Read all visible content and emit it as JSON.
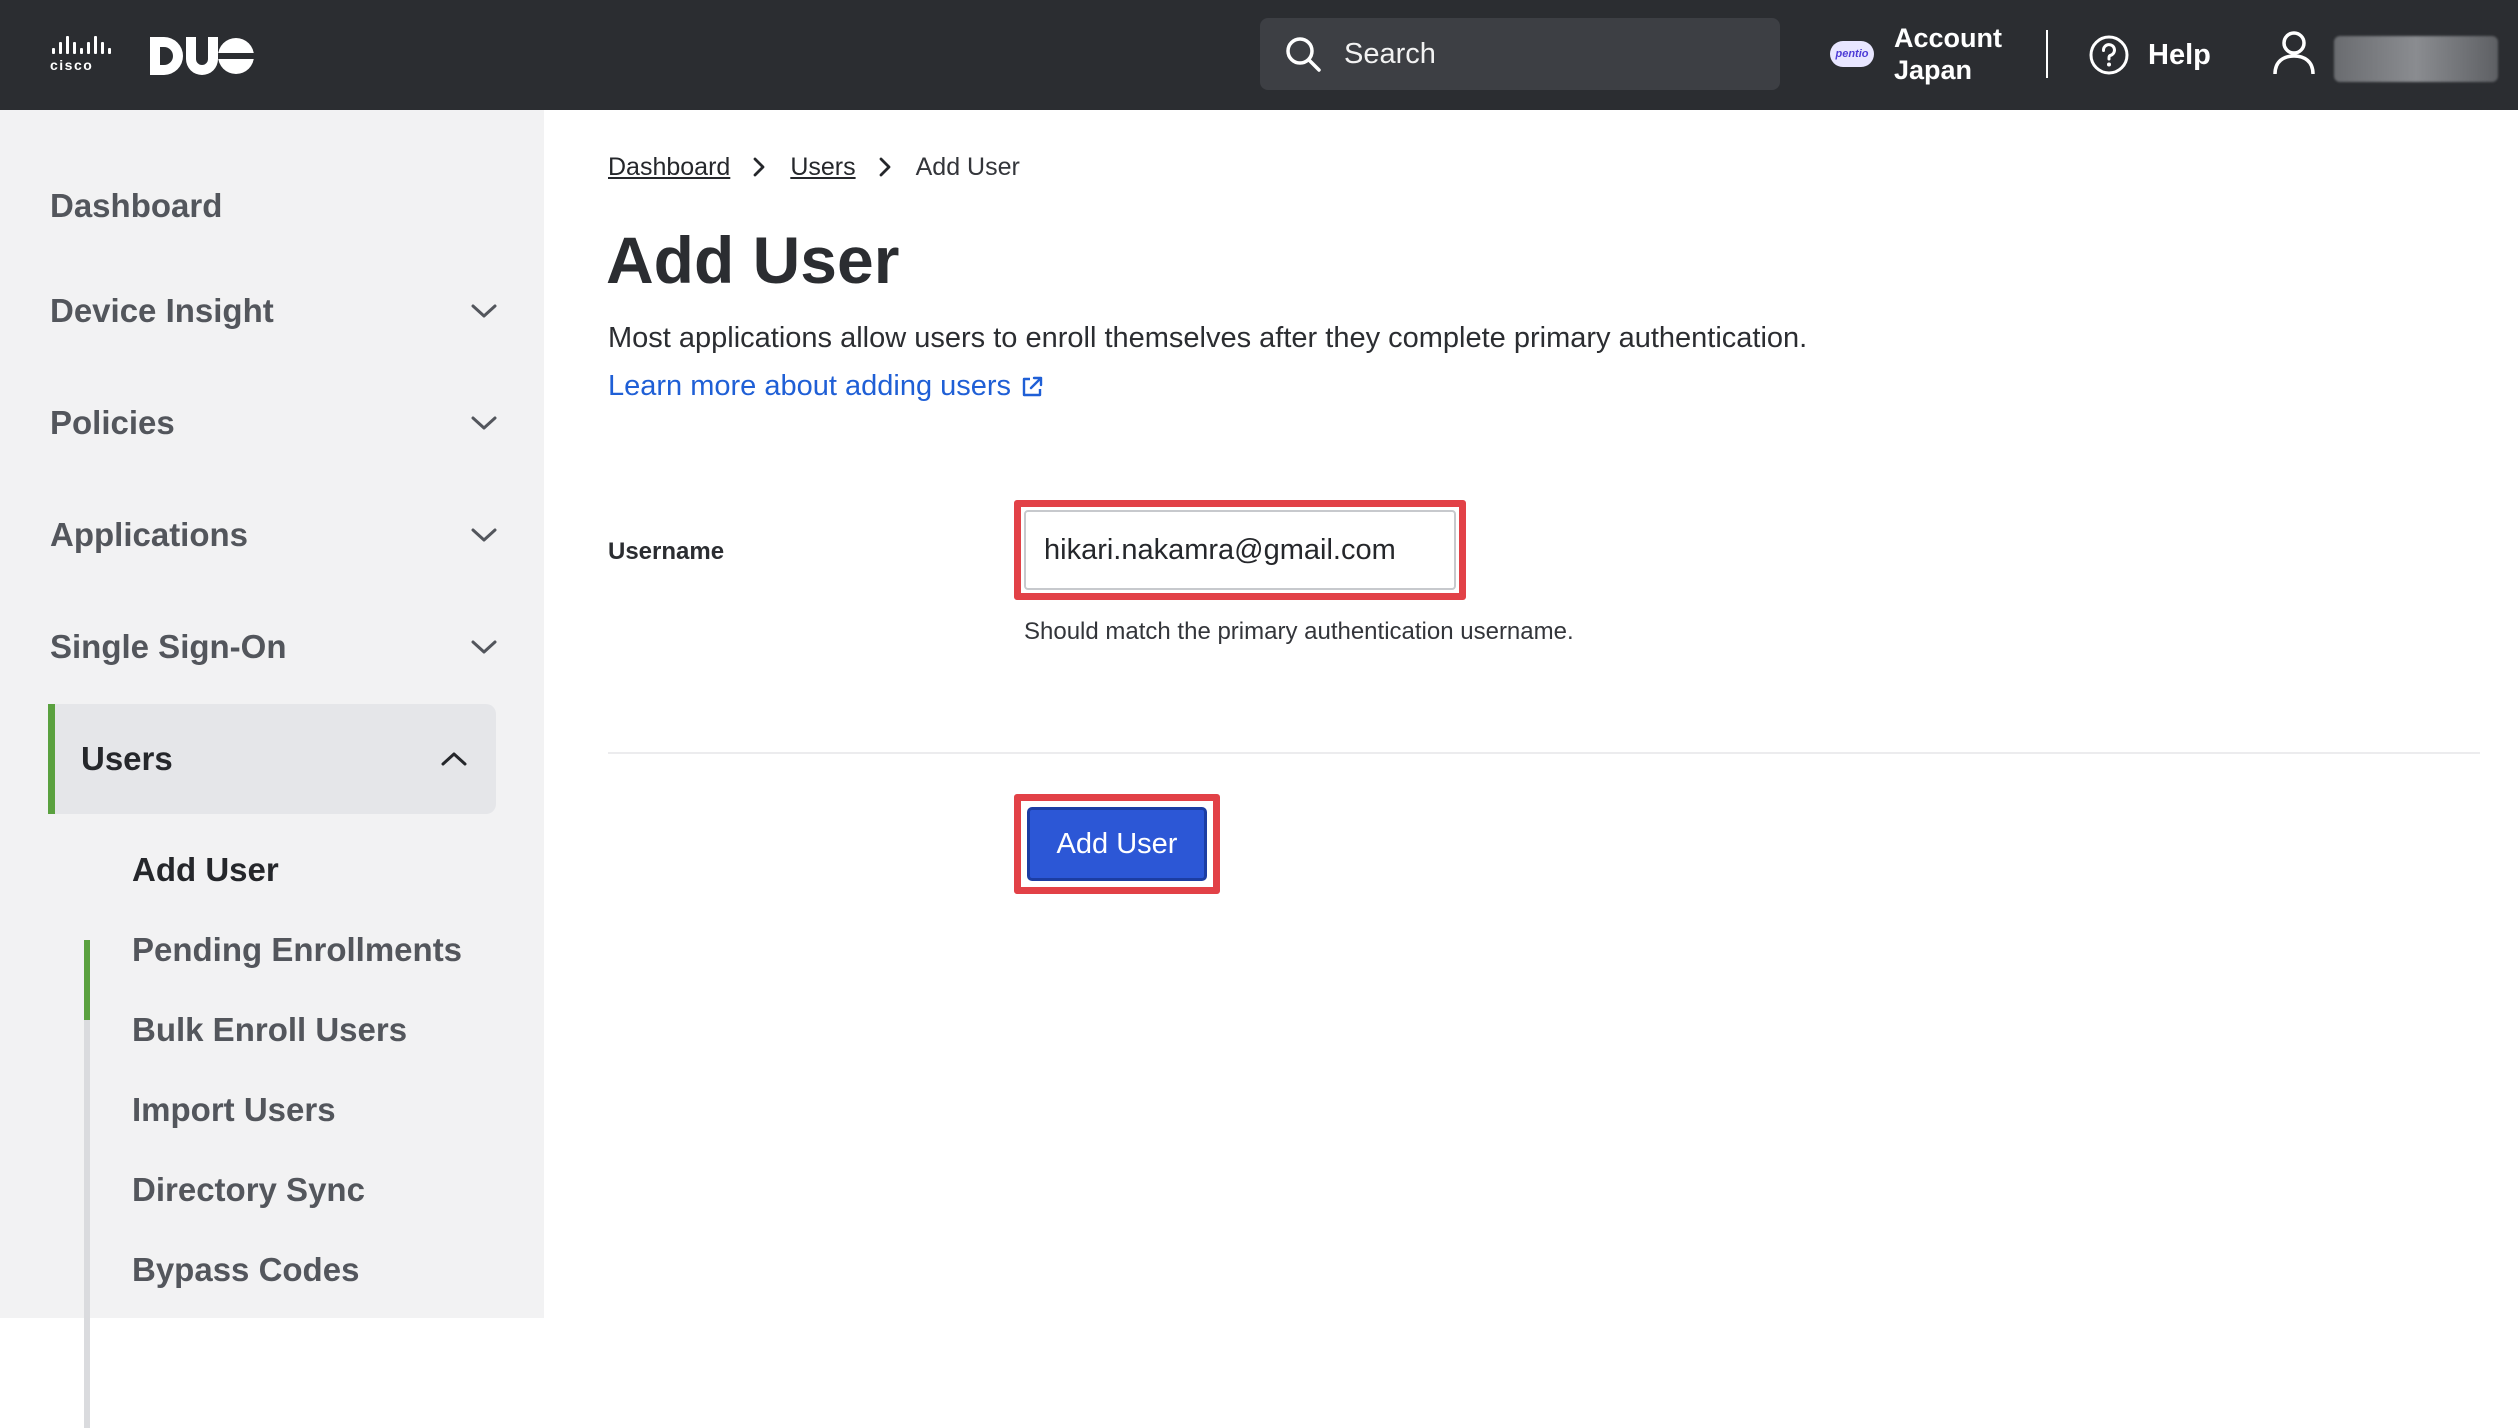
{
  "topbar": {
    "brand_cisco": "cisco",
    "search_placeholder": "Search",
    "account_badge": "pentio",
    "account_line1": "Account",
    "account_line2": "Japan",
    "help_label": "Help"
  },
  "sidebar": {
    "items": [
      {
        "label": "Dashboard"
      },
      {
        "label": "Device Insight"
      },
      {
        "label": "Policies"
      },
      {
        "label": "Applications"
      },
      {
        "label": "Single Sign-On"
      },
      {
        "label": "Users"
      }
    ],
    "sub_items": [
      {
        "label": "Add User"
      },
      {
        "label": "Pending Enrollments"
      },
      {
        "label": "Bulk Enroll Users"
      },
      {
        "label": "Import Users"
      },
      {
        "label": "Directory Sync"
      },
      {
        "label": "Bypass Codes"
      }
    ]
  },
  "breadcrumb": {
    "items": [
      "Dashboard",
      "Users"
    ],
    "current": "Add User"
  },
  "main": {
    "title": "Add User",
    "description": "Most applications allow users to enroll themselves after they complete primary authentication.",
    "learn_more": "Learn more about adding users",
    "username_label": "Username",
    "username_value": "hikari.nakamra@gmail.com",
    "username_hint": "Should match the primary authentication username.",
    "submit_label": "Add User"
  },
  "colors": {
    "topbar_bg": "#2b2d31",
    "accent_green": "#5aa13f",
    "link_blue": "#1f5fd6",
    "button_blue": "#2c57d6",
    "highlight_red": "#e24147"
  }
}
